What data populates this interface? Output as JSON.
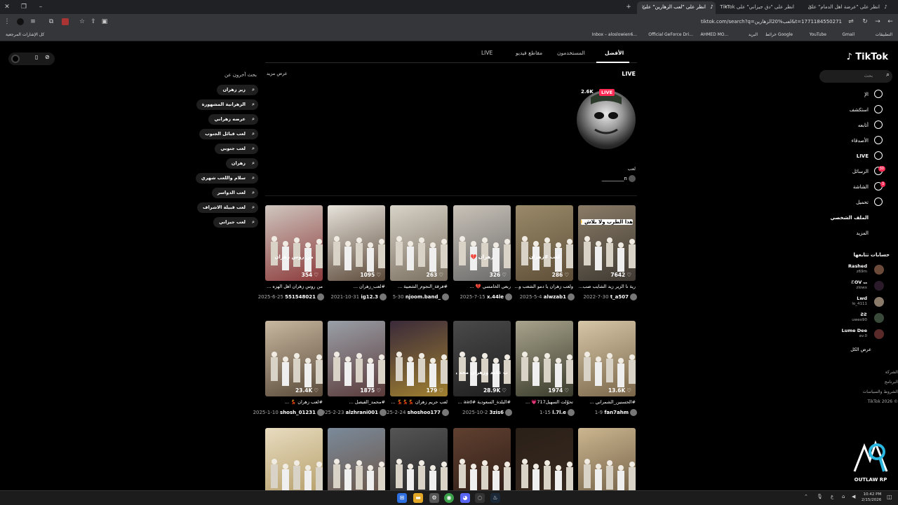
{
  "browser": {
    "tabs": [
      {
        "label": "انظر على \"عرضة اهل الدمام\" على"
      },
      {
        "label": "انظر على \"دق جيزاني\" على TikTok"
      },
      {
        "label": "انظر على \"لعب الزهارين\" على"
      }
    ],
    "url": "tiktok.com/search?q=لعب%20الزهارين&t=1771184550271",
    "bookmarks": [
      "التطبيقات",
      "Gmail",
      "YouTube",
      "خرائط Google",
      "البريد",
      "AHMED MO...",
      "Official GeForce Dri...",
      "Inbox – aloslowien6...",
      "كل الإشارات المرجعية"
    ]
  },
  "tiktok": {
    "logo": "TikTok",
    "search_placeholder": "بحث",
    "nav": [
      {
        "label": "الإ",
        "icon": "home-icon"
      },
      {
        "label": "استكشف",
        "icon": "compass-icon"
      },
      {
        "label": "أتابعه",
        "icon": "following-icon"
      },
      {
        "label": "الأصدقاء",
        "icon": "friends-icon"
      },
      {
        "label": "LIVE",
        "icon": "live-icon"
      },
      {
        "label": "الرسائل",
        "icon": "messages-icon",
        "badge": "30"
      },
      {
        "label": "الشاشة",
        "icon": "inbox-icon",
        "badge": "3"
      },
      {
        "label": "تحميل",
        "icon": "upload-icon"
      },
      {
        "label": "الملف الشخصي",
        "icon": "profile-icon"
      },
      {
        "label": "المزيد",
        "icon": "more-icon"
      }
    ],
    "following_title": "حسابات تتابعها",
    "following": [
      {
        "name": "Rashed",
        "handle": "z69m"
      },
      {
        "name": "ℰOV ₛₐ",
        "handle": "zlowx"
      },
      {
        "name": "Lwd",
        "handle": "lo_4111"
      },
      {
        "name": "ƧƧ",
        "handle": "uweo90"
      },
      {
        "name": "Lume Dee",
        "handle": "av.0"
      }
    ],
    "see_all": "عرض الكل",
    "footer": [
      "الشركة",
      "البرنامج",
      "الشروط والسياسات",
      "TikTok 2026 ©"
    ],
    "search_tabs": [
      {
        "label": "الأفضل",
        "active": true
      },
      {
        "label": "المستخدمون",
        "active": false
      },
      {
        "label": "مقاطع فيديو",
        "active": false
      },
      {
        "label": "LIVE",
        "active": false
      }
    ],
    "live_section": {
      "title": "LIVE",
      "viewers": "2.6K",
      "badge": "LIVE",
      "caption": "لعب",
      "user": "n_________"
    },
    "related": {
      "title": "بحث آخرون عن",
      "show_more": "عرض مزيد",
      "chips": [
        "زير زهران",
        "الزهرانية المشهورة",
        "عرضه زهراني",
        "لعب قبائل الجنوب",
        "لعب جنوبي",
        "زهران",
        "سلام واللعب شهري",
        "لعب الدواسر",
        "لعب قبيلة الاشراف",
        "لعب جيزاني"
      ]
    },
    "videos_row1": [
      {
        "count": "7642",
        "caption": "رية نا الزير زيد الشايب صب...",
        "user": "t_a507",
        "date": "2022-7-30",
        "overlay": "هذا الطرب ولا بلاش 🙂🔥",
        "c1": "#8a7b66",
        "c2": "#3f3a33"
      },
      {
        "count": "286",
        "caption": "ولعب زهران يا دمو الشعب و...",
        "user": "alwzab1",
        "date": "2025-5-4",
        "overlay": "لعب #زهران",
        "c1": "#9a8a6a",
        "c2": "#5e4e37"
      },
      {
        "count": "326",
        "caption": "ربعي الخامسي 💔 ...",
        "user": "x.44le",
        "date": "2025-7-15",
        "overlay": "زهران 💔",
        "c1": "#c9c2b8",
        "c2": "#6a6a6a"
      },
      {
        "count": "263",
        "caption": "#فرقة_النجوم_الشعبية ...",
        "user": "njoom.band_",
        "date": "5-30",
        "overlay": "",
        "c1": "#d8d3c8",
        "c2": "#7a6f60"
      },
      {
        "count": "1095",
        "caption": "#لعب_زهران ...",
        "user": "ig12.3",
        "date": "2021-10-31",
        "overlay": "",
        "c1": "#e7e3dc",
        "c2": "#5c4a3a"
      },
      {
        "count": "354",
        "caption": "من روس زهران اهل الهزه ...",
        "user": "551548021",
        "date": "2025-6-25",
        "overlay": "من روس زهران",
        "c1": "#cfc6bf",
        "c2": "#8c3b3b"
      }
    ],
    "videos_row2": [
      {
        "count": "13.6K",
        "caption": "#الحسنين_الشمراني ...",
        "user": "fan7ahm",
        "date": "1-9",
        "overlay": "",
        "c1": "#d6c7a8",
        "c2": "#7b6649"
      },
      {
        "count": "1974",
        "caption": "تحوّلت السهيل717💗 ...",
        "user": "l.7l.e",
        "date": "1-15",
        "overlay": "",
        "c1": "#a8a38c",
        "c2": "#3a3b2c"
      },
      {
        "count": "28.9K",
        "caption": "#البلدة_السعودية #aad ...",
        "user": "3zis6",
        "date": "2025-10-2",
        "overlay": "ب غامد وزهران محد يتعداه",
        "c1": "#4a4a4a",
        "c2": "#1e1e1e"
      },
      {
        "count": "179",
        "caption": "لعب حريم زهران 💃💃💃 ...",
        "user": "shoshoo177",
        "date": "2025-2-24",
        "overlay": "",
        "c1": "#3a2a3a",
        "c2": "#a08030"
      },
      {
        "count": "1875",
        "caption": "#محمد_الفيصل ...",
        "user": "alzhrani001",
        "date": "2025-2-23",
        "overlay": "",
        "c1": "#9aa0a8",
        "c2": "#5a3a3a"
      },
      {
        "count": "23.4K",
        "caption": "#لعب زهران 💃 ...",
        "user": "shosh_01231",
        "date": "2025-1-10",
        "overlay": "",
        "c1": "#c8b8a0",
        "c2": "#5a4a3a"
      }
    ],
    "videos_row3": [
      {
        "c1": "#ccb690",
        "c2": "#6a5840"
      },
      {
        "c1": "#2a2018",
        "c2": "#3a2a20"
      },
      {
        "c1": "#604030",
        "c2": "#2a1a14"
      },
      {
        "c1": "#555555",
        "c2": "#222222"
      },
      {
        "c1": "#7a8a9a",
        "c2": "#6a5040"
      },
      {
        "c1": "#e8dcc0",
        "c2": "#b09860"
      }
    ]
  },
  "watermark": "OUTLAW RP",
  "taskbar": {
    "time": "10:42 PM",
    "date": "2/15/2026"
  }
}
